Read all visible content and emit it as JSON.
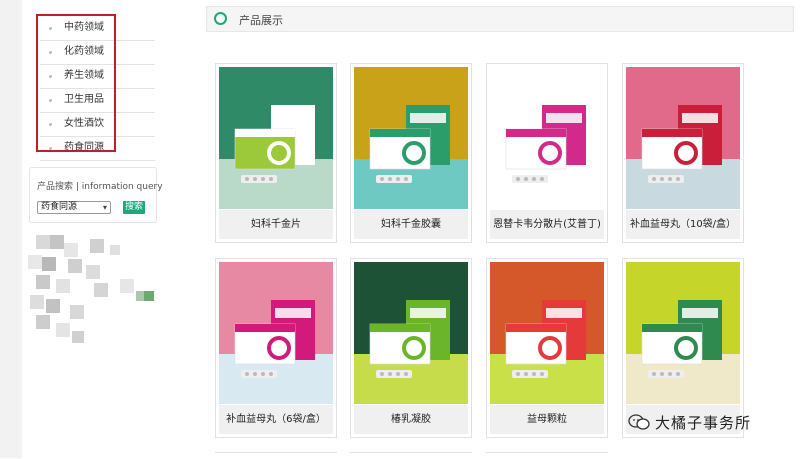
{
  "sidebar": {
    "categories": [
      {
        "label": "中药领域"
      },
      {
        "label": "化药领域"
      },
      {
        "label": "养生领域"
      },
      {
        "label": "卫生用品"
      },
      {
        "label": "女性酒饮"
      },
      {
        "label": "药食同源"
      }
    ],
    "search": {
      "title": "产品搜索 | information query",
      "selected": "药食同源",
      "button": "搜索"
    }
  },
  "main": {
    "section_title": "产品展示",
    "products": [
      {
        "name": "妇科千金片",
        "bg": "#2f8a68",
        "floor": "#b9d9c9",
        "box": "#9cc93a",
        "box2": "#ffffff",
        "icon": "box-product-image"
      },
      {
        "name": "妇科千金胶囊",
        "bg": "#c9a21a",
        "floor": "#6ec9c2",
        "box": "#ffffff",
        "box2": "#2a9d6a",
        "icon": "capsule-product-image"
      },
      {
        "name": "恩替卡韦分散片(艾普丁)",
        "bg": "#ffffff",
        "floor": "#ffffff",
        "box": "#ffffff",
        "box2": "#d22a8a",
        "icon": "tablet-box-product-image"
      },
      {
        "name": "补血益母丸（10袋/盒）",
        "bg": "#e16a8a",
        "floor": "#c9d9e0",
        "box": "#ffffff",
        "box2": "#c91f3a",
        "icon": "pill-box-product-image"
      },
      {
        "name": "补血益母丸（6袋/盒）",
        "bg": "#e889a4",
        "floor": "#d9e9f2",
        "box": "#ffffff",
        "box2": "#d21a7a",
        "icon": "pill-box-product-image"
      },
      {
        "name": "椿乳凝胶",
        "bg": "#1d5236",
        "floor": "#c6dc4a",
        "box": "#ffffff",
        "box2": "#6ab52a",
        "icon": "gel-box-product-image"
      },
      {
        "name": "益母颗粒",
        "bg": "#d4582a",
        "floor": "#c9e048",
        "box": "#ffffff",
        "box2": "#e43a3a",
        "icon": "granule-box-product-image"
      },
      {
        "name": "大橘子事务所",
        "bg": "#c6d52a",
        "floor": "#efe9c9",
        "box": "#ffffff",
        "box2": "#2f8a50",
        "icon": "box-product-image"
      }
    ]
  },
  "watermark": {
    "text": "大橘子事务所"
  },
  "colors": {
    "accent": "#1aa97c",
    "highlight_border": "#c01f25"
  }
}
